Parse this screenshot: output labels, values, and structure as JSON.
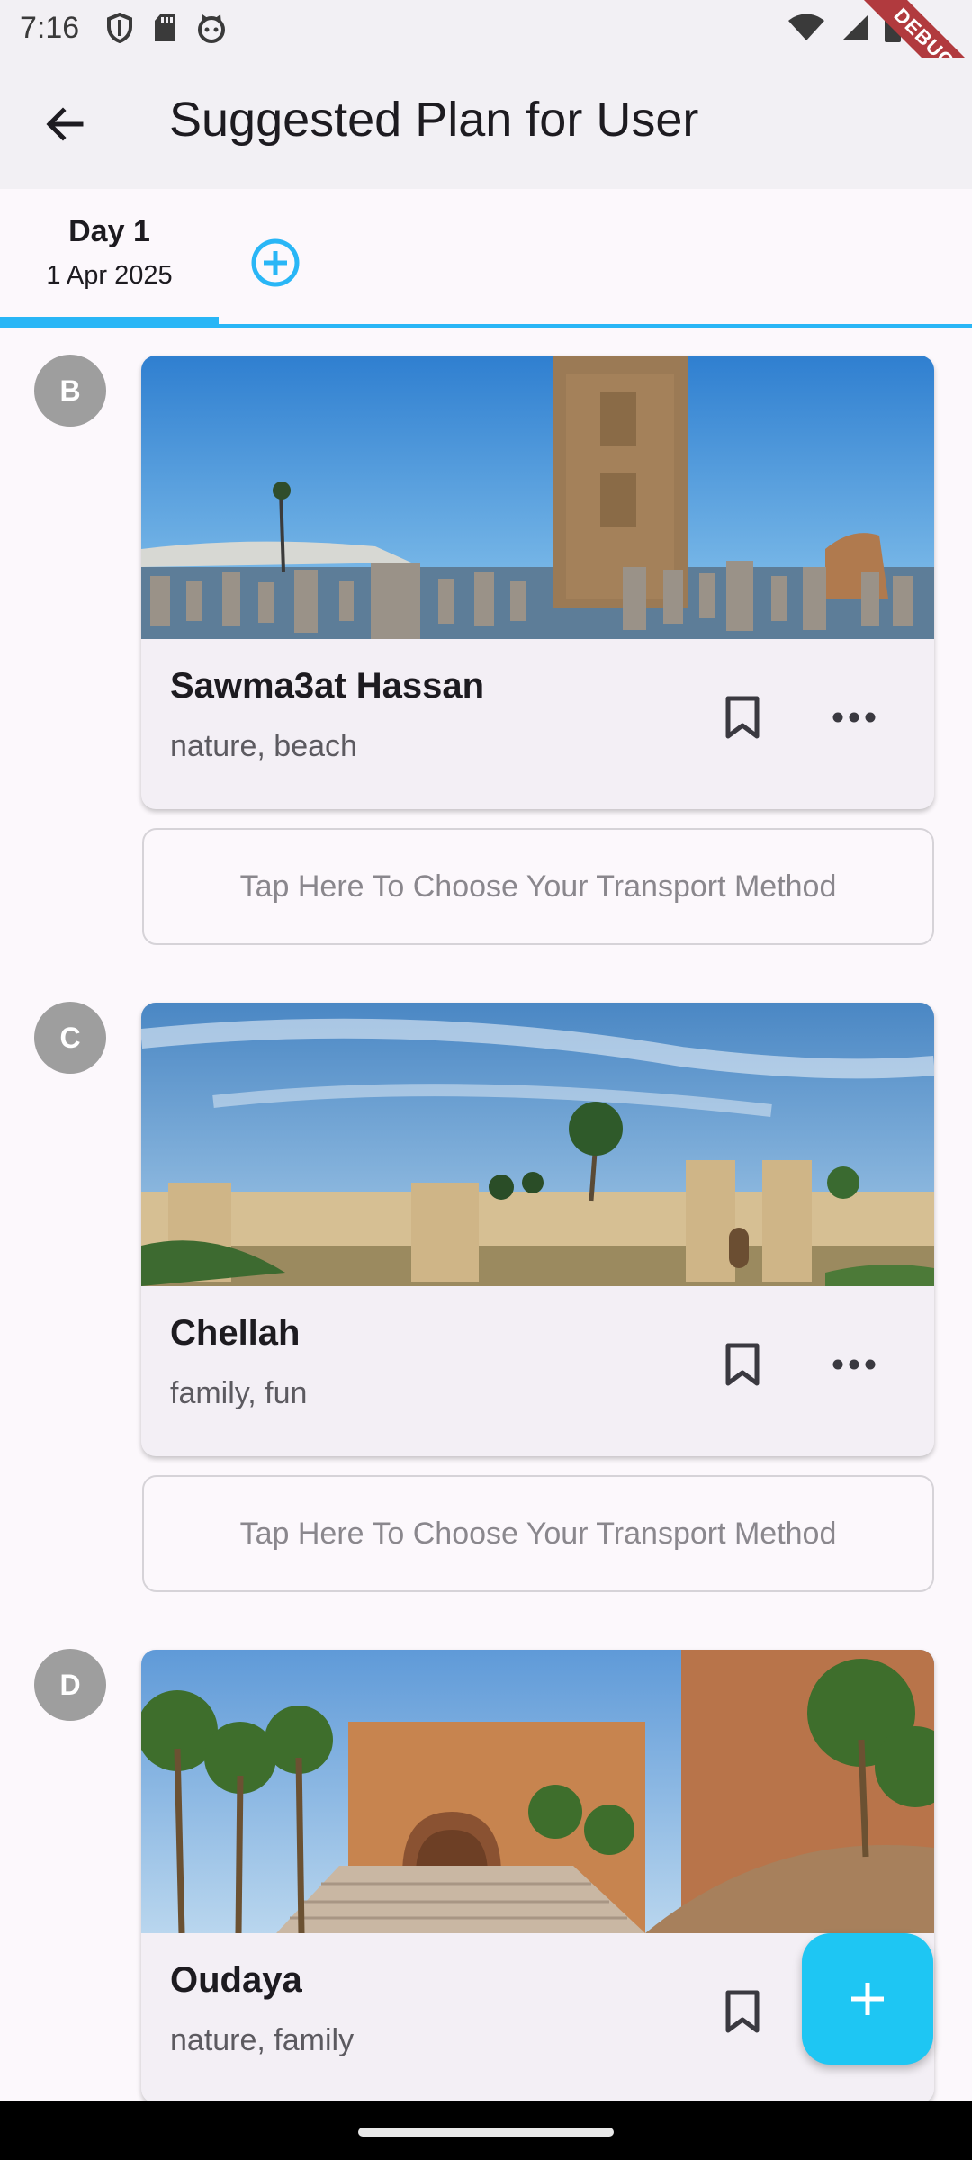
{
  "status_bar": {
    "time": "7:16",
    "left_icons": [
      "shield-icon",
      "sd-card-icon",
      "cat-face-icon"
    ],
    "right_icons": [
      "wifi-icon",
      "signal-icon",
      "battery-icon"
    ],
    "debug_label": "DEBUG"
  },
  "app_bar": {
    "back_icon": "arrow-back-icon",
    "title": "Suggested Plan for User"
  },
  "tabs": {
    "items": [
      {
        "title": "Day 1",
        "date": "1 Apr 2025",
        "selected": true
      }
    ],
    "add_icon": "add-circle-icon",
    "accent_color": "#29b6f6"
  },
  "stops": [
    {
      "badge": "B",
      "title": "Sawma3at Hassan",
      "tags": "nature, beach",
      "image": "hassan-tower-photo",
      "transport_label": "Tap Here To Choose Your Transport Method"
    },
    {
      "badge": "C",
      "title": "Chellah",
      "tags": "family, fun",
      "image": "chellah-walls-photo",
      "transport_label": "Tap Here To Choose Your Transport Method"
    },
    {
      "badge": "D",
      "title": "Oudaya",
      "tags": "nature, family",
      "image": "oudaya-gate-photo"
    }
  ],
  "fab": {
    "icon": "plus-icon",
    "color": "#1ec6f3"
  }
}
